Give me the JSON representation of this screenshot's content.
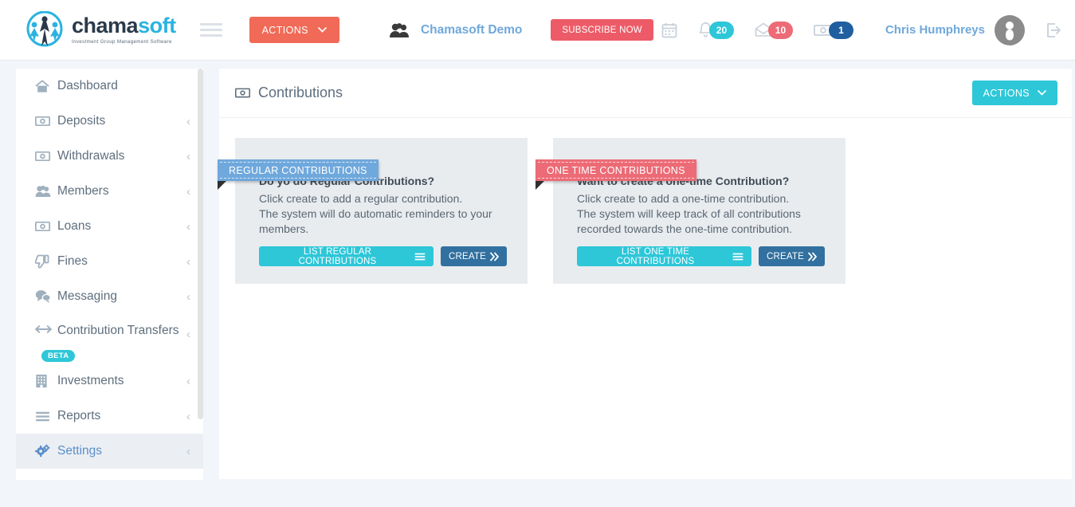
{
  "brand": {
    "name_part1": "chama",
    "name_part2": "soft",
    "tagline": "Investment Group Management Software",
    "logo_icon": "chamasoft-people-logo"
  },
  "topbar": {
    "menu_toggle_icon": "hamburger-menu-icon",
    "actions_label": "ACTIONS",
    "actions_caret_icon": "chevron-down-icon",
    "group_icon": "users-group-icon",
    "group_name": "Chamasoft Demo",
    "subscribe_label": "SUBSCRIBE NOW",
    "calendar_icon": "calendar-icon",
    "bell_icon": "bell-icon",
    "bell_count": "20",
    "bell_badge_color": "#2DC7D8",
    "mail_icon": "envelope-open-icon",
    "mail_count": "10",
    "mail_badge_color": "#EC6B76",
    "money_icon": "money-bill-icon",
    "money_count": "1",
    "money_badge_color": "#1F5FA0",
    "username": "Chris Humphreys",
    "avatar_icon": "user-avatar-icon",
    "logout_icon": "sign-out-icon"
  },
  "sidebar": {
    "items": [
      {
        "label": "Dashboard",
        "icon": "home-icon",
        "chevron": false,
        "active": false,
        "badge": null
      },
      {
        "label": "Deposits",
        "icon": "money-bill-icon",
        "chevron": true,
        "active": false,
        "badge": null
      },
      {
        "label": "Withdrawals",
        "icon": "money-bill-icon",
        "chevron": true,
        "active": false,
        "badge": null
      },
      {
        "label": "Members",
        "icon": "users-group-icon",
        "chevron": true,
        "active": false,
        "badge": null
      },
      {
        "label": "Loans",
        "icon": "money-bill-icon",
        "chevron": true,
        "active": false,
        "badge": null
      },
      {
        "label": "Fines",
        "icon": "thumbs-down-icon",
        "chevron": true,
        "active": false,
        "badge": null
      },
      {
        "label": "Messaging",
        "icon": "comments-icon",
        "chevron": true,
        "active": false,
        "badge": null
      },
      {
        "label": "Contribution Transfers",
        "icon": "arrows-left-right-icon",
        "chevron": true,
        "active": false,
        "badge": "BETA"
      },
      {
        "label": "Investments",
        "icon": "building-icon",
        "chevron": true,
        "active": false,
        "badge": null
      },
      {
        "label": "Reports",
        "icon": "list-icon",
        "chevron": true,
        "active": false,
        "badge": null
      },
      {
        "label": "Settings",
        "icon": "gears-icon",
        "chevron": true,
        "active": true,
        "badge": null
      }
    ],
    "chevron_icon": "chevron-left-icon",
    "scrollbar": "sidebar-scrollbar"
  },
  "main": {
    "title": "Contributions",
    "title_icon": "money-bill-icon",
    "actions_label": "ACTIONS",
    "actions_caret_icon": "chevron-down-icon",
    "cards": [
      {
        "ribbon": "REGULAR CONTRIBUTIONS",
        "ribbon_color": "#6FA8DC",
        "heading": "Do yo do Regular Contributions?",
        "body_line1": "Click create to add a regular contribution.",
        "body_line2": "The system will do automatic reminders to your",
        "body_line3": "members.",
        "list_button": "LIST REGULAR CONTRIBUTIONS",
        "list_button_icon": "list-icon",
        "create_button": "CREATE",
        "create_button_icon": "double-chevron-right-icon"
      },
      {
        "ribbon": "ONE TIME CONTRIBUTIONS",
        "ribbon_color": "#EC6B76",
        "heading": "Want to create a one-time Contribution?",
        "body_line1": "Click create to add a one-time contribution.",
        "body_line2": "The system will keep track of all contributions",
        "body_line3": "recorded towards the one-time contribution.",
        "list_button": "LIST ONE TIME CONTRIBUTIONS",
        "list_button_icon": "list-icon",
        "create_button": "CREATE",
        "create_button_icon": "double-chevron-right-icon"
      }
    ]
  }
}
